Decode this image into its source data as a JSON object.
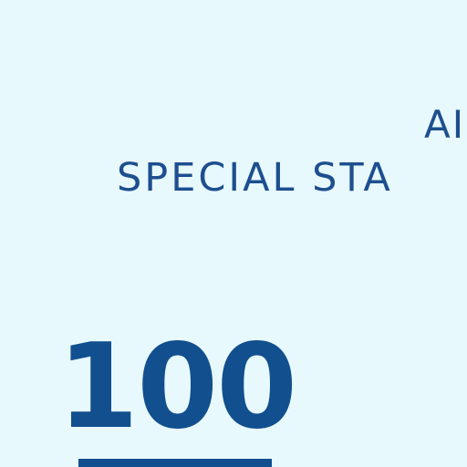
{
  "header": {
    "line1": "AI",
    "line2": "SPECIAL STA"
  },
  "main": {
    "denomination": "100"
  },
  "colors": {
    "background": "#e8f9fd",
    "text": "#1d4f8f",
    "numeral": "#114f8e"
  }
}
